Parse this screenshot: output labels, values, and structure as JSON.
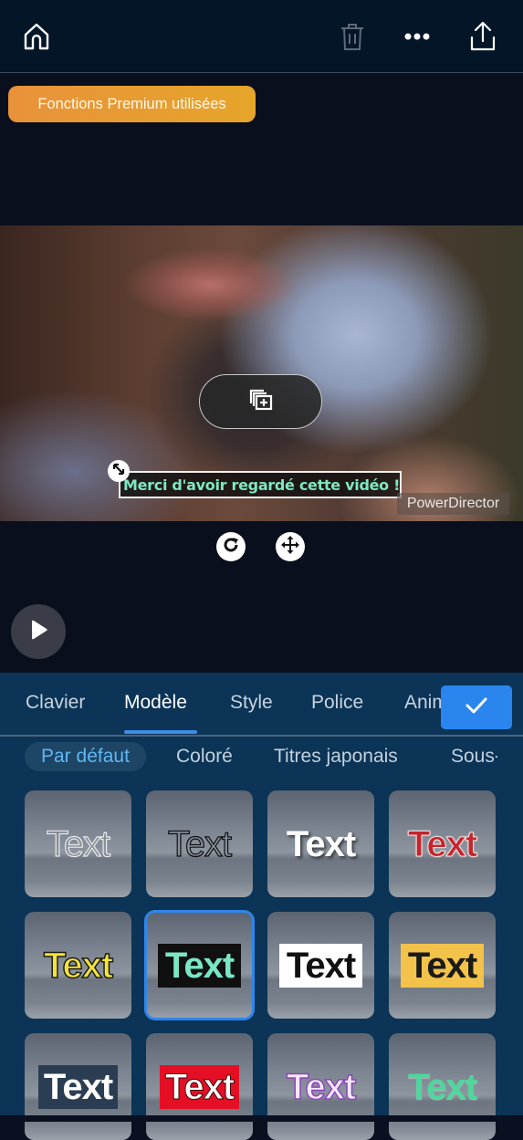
{
  "topbar": {
    "icons": [
      {
        "name": "home-icon"
      },
      {
        "name": "trash-icon",
        "state": "disabled"
      },
      {
        "name": "more-icon"
      },
      {
        "name": "share-icon"
      }
    ]
  },
  "premium_badge": "Fonctions Premium utilisées",
  "preview": {
    "caption": "Merci d'avoir regardé cette vidéo !",
    "watermark": "PowerDirector",
    "insert_icon": "add-layer-icon",
    "controls": [
      "rotate-icon",
      "move-icon"
    ],
    "play_icon": "play-icon"
  },
  "tabs": [
    {
      "label": "Clavier",
      "active": false
    },
    {
      "label": "Modèle",
      "active": true
    },
    {
      "label": "Style",
      "active": false
    },
    {
      "label": "Police",
      "active": false
    },
    {
      "label": "Animation",
      "active": false
    }
  ],
  "confirm_icon": "check-icon",
  "categories": [
    {
      "label": "Par défaut",
      "active": true
    },
    {
      "label": "Coloré",
      "active": false
    },
    {
      "label": "Titres japonais",
      "active": false
    },
    {
      "label": "Sous-titres",
      "active": false
    }
  ],
  "templates": [
    {
      "label": "Text",
      "style": "outline-white",
      "selected": false
    },
    {
      "label": "Text",
      "style": "outline-black",
      "selected": false
    },
    {
      "label": "Text",
      "style": "white-shadow",
      "selected": false
    },
    {
      "label": "Text",
      "style": "red-outline",
      "selected": false
    },
    {
      "label": "Text",
      "style": "yellow-black-outline",
      "selected": false
    },
    {
      "label": "Text",
      "style": "mint-on-black",
      "selected": true
    },
    {
      "label": "Text",
      "style": "black-on-white",
      "selected": false
    },
    {
      "label": "Text",
      "style": "black-on-yellow",
      "selected": false
    },
    {
      "label": "Text",
      "style": "white-on-navy",
      "selected": false
    },
    {
      "label": "Text",
      "style": "white-on-red",
      "selected": false
    },
    {
      "label": "Text",
      "style": "lilac-outline",
      "selected": false
    },
    {
      "label": "Text",
      "style": "green",
      "selected": false
    }
  ],
  "colors": {
    "accent": "#2a86ee",
    "premium": "#e8923a",
    "caption_text": "#7ee8c0",
    "panel_bg": "#0b3456"
  }
}
